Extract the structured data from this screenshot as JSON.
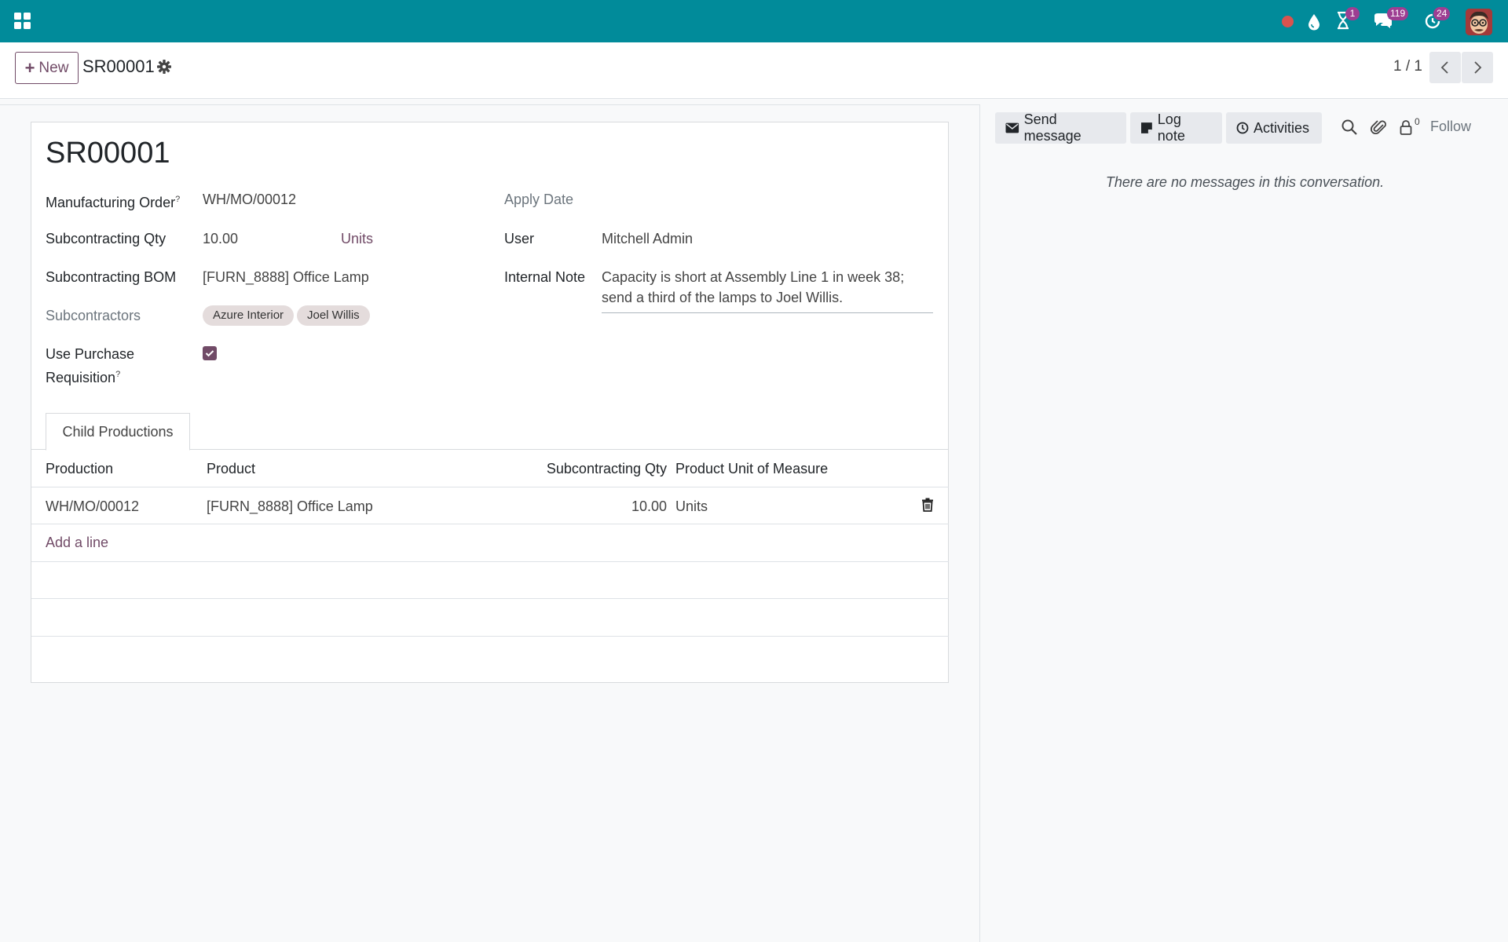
{
  "navbar": {
    "activities_count": "1",
    "messages_count": "119",
    "timer_count": "24"
  },
  "control_panel": {
    "new_label": "New",
    "breadcrumb": "SR00001",
    "pager": "1 / 1"
  },
  "form": {
    "title": "SR00001",
    "fields": {
      "manufacturing_order": {
        "label": "Manufacturing Order",
        "help": "?",
        "value": "WH/MO/00012"
      },
      "subcontracting_qty": {
        "label": "Subcontracting Qty",
        "value": "10.00",
        "uom": "Units"
      },
      "subcontracting_bom": {
        "label": "Subcontracting BOM",
        "value": "[FURN_8888] Office Lamp"
      },
      "subcontractors": {
        "label": "Subcontractors",
        "tags": [
          "Azure Interior",
          "Joel Willis"
        ]
      },
      "use_purchase_requisition": {
        "label_line1": "Use Purchase",
        "label_line2": "Requisition",
        "help": "?",
        "checked": true
      },
      "apply_date": {
        "label": "Apply Date",
        "value": ""
      },
      "user": {
        "label": "User",
        "value": "Mitchell Admin"
      },
      "internal_note": {
        "label": "Internal Note",
        "line1": "Capacity is short at Assembly Line 1 in week 38;",
        "line2": "send a third of the lamps to Joel Willis."
      }
    },
    "notebook": {
      "tab_label": "Child Productions",
      "columns": [
        "Production",
        "Product",
        "Subcontracting Qty",
        "Product Unit of Measure"
      ],
      "rows": [
        {
          "production": "WH/MO/00012",
          "product": "[FURN_8888] Office Lamp",
          "qty": "10.00",
          "uom": "Units"
        }
      ],
      "add_line": "Add a line"
    }
  },
  "chatter": {
    "send_message": "Send message",
    "log_note": "Log note",
    "activities": "Activities",
    "follower_count": "0",
    "follow": "Follow",
    "empty": "There are no messages in this conversation."
  },
  "colors": {
    "navbar": "#018b9a",
    "primary": "#714b67",
    "badge": "#9d3e92"
  }
}
